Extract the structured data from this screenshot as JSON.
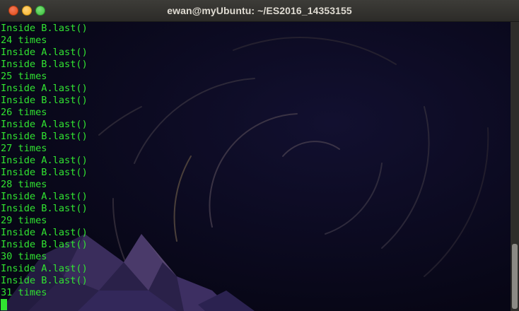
{
  "window": {
    "title": "ewan@myUbuntu: ~/ES2016_14353155"
  },
  "terminal": {
    "text_color": "#31e331",
    "lines": [
      "Inside B.last()",
      "24 times",
      "Inside A.last()",
      "Inside B.last()",
      "25 times",
      "Inside A.last()",
      "Inside B.last()",
      "26 times",
      "Inside A.last()",
      "Inside B.last()",
      "27 times",
      "Inside A.last()",
      "Inside B.last()",
      "28 times",
      "Inside A.last()",
      "Inside B.last()",
      "29 times",
      "Inside A.last()",
      "Inside B.last()",
      "30 times",
      "Inside A.last()",
      "Inside B.last()",
      "31 times"
    ]
  },
  "icons": {
    "close": "close-icon",
    "minimize": "minimize-icon",
    "maximize": "maximize-icon"
  }
}
